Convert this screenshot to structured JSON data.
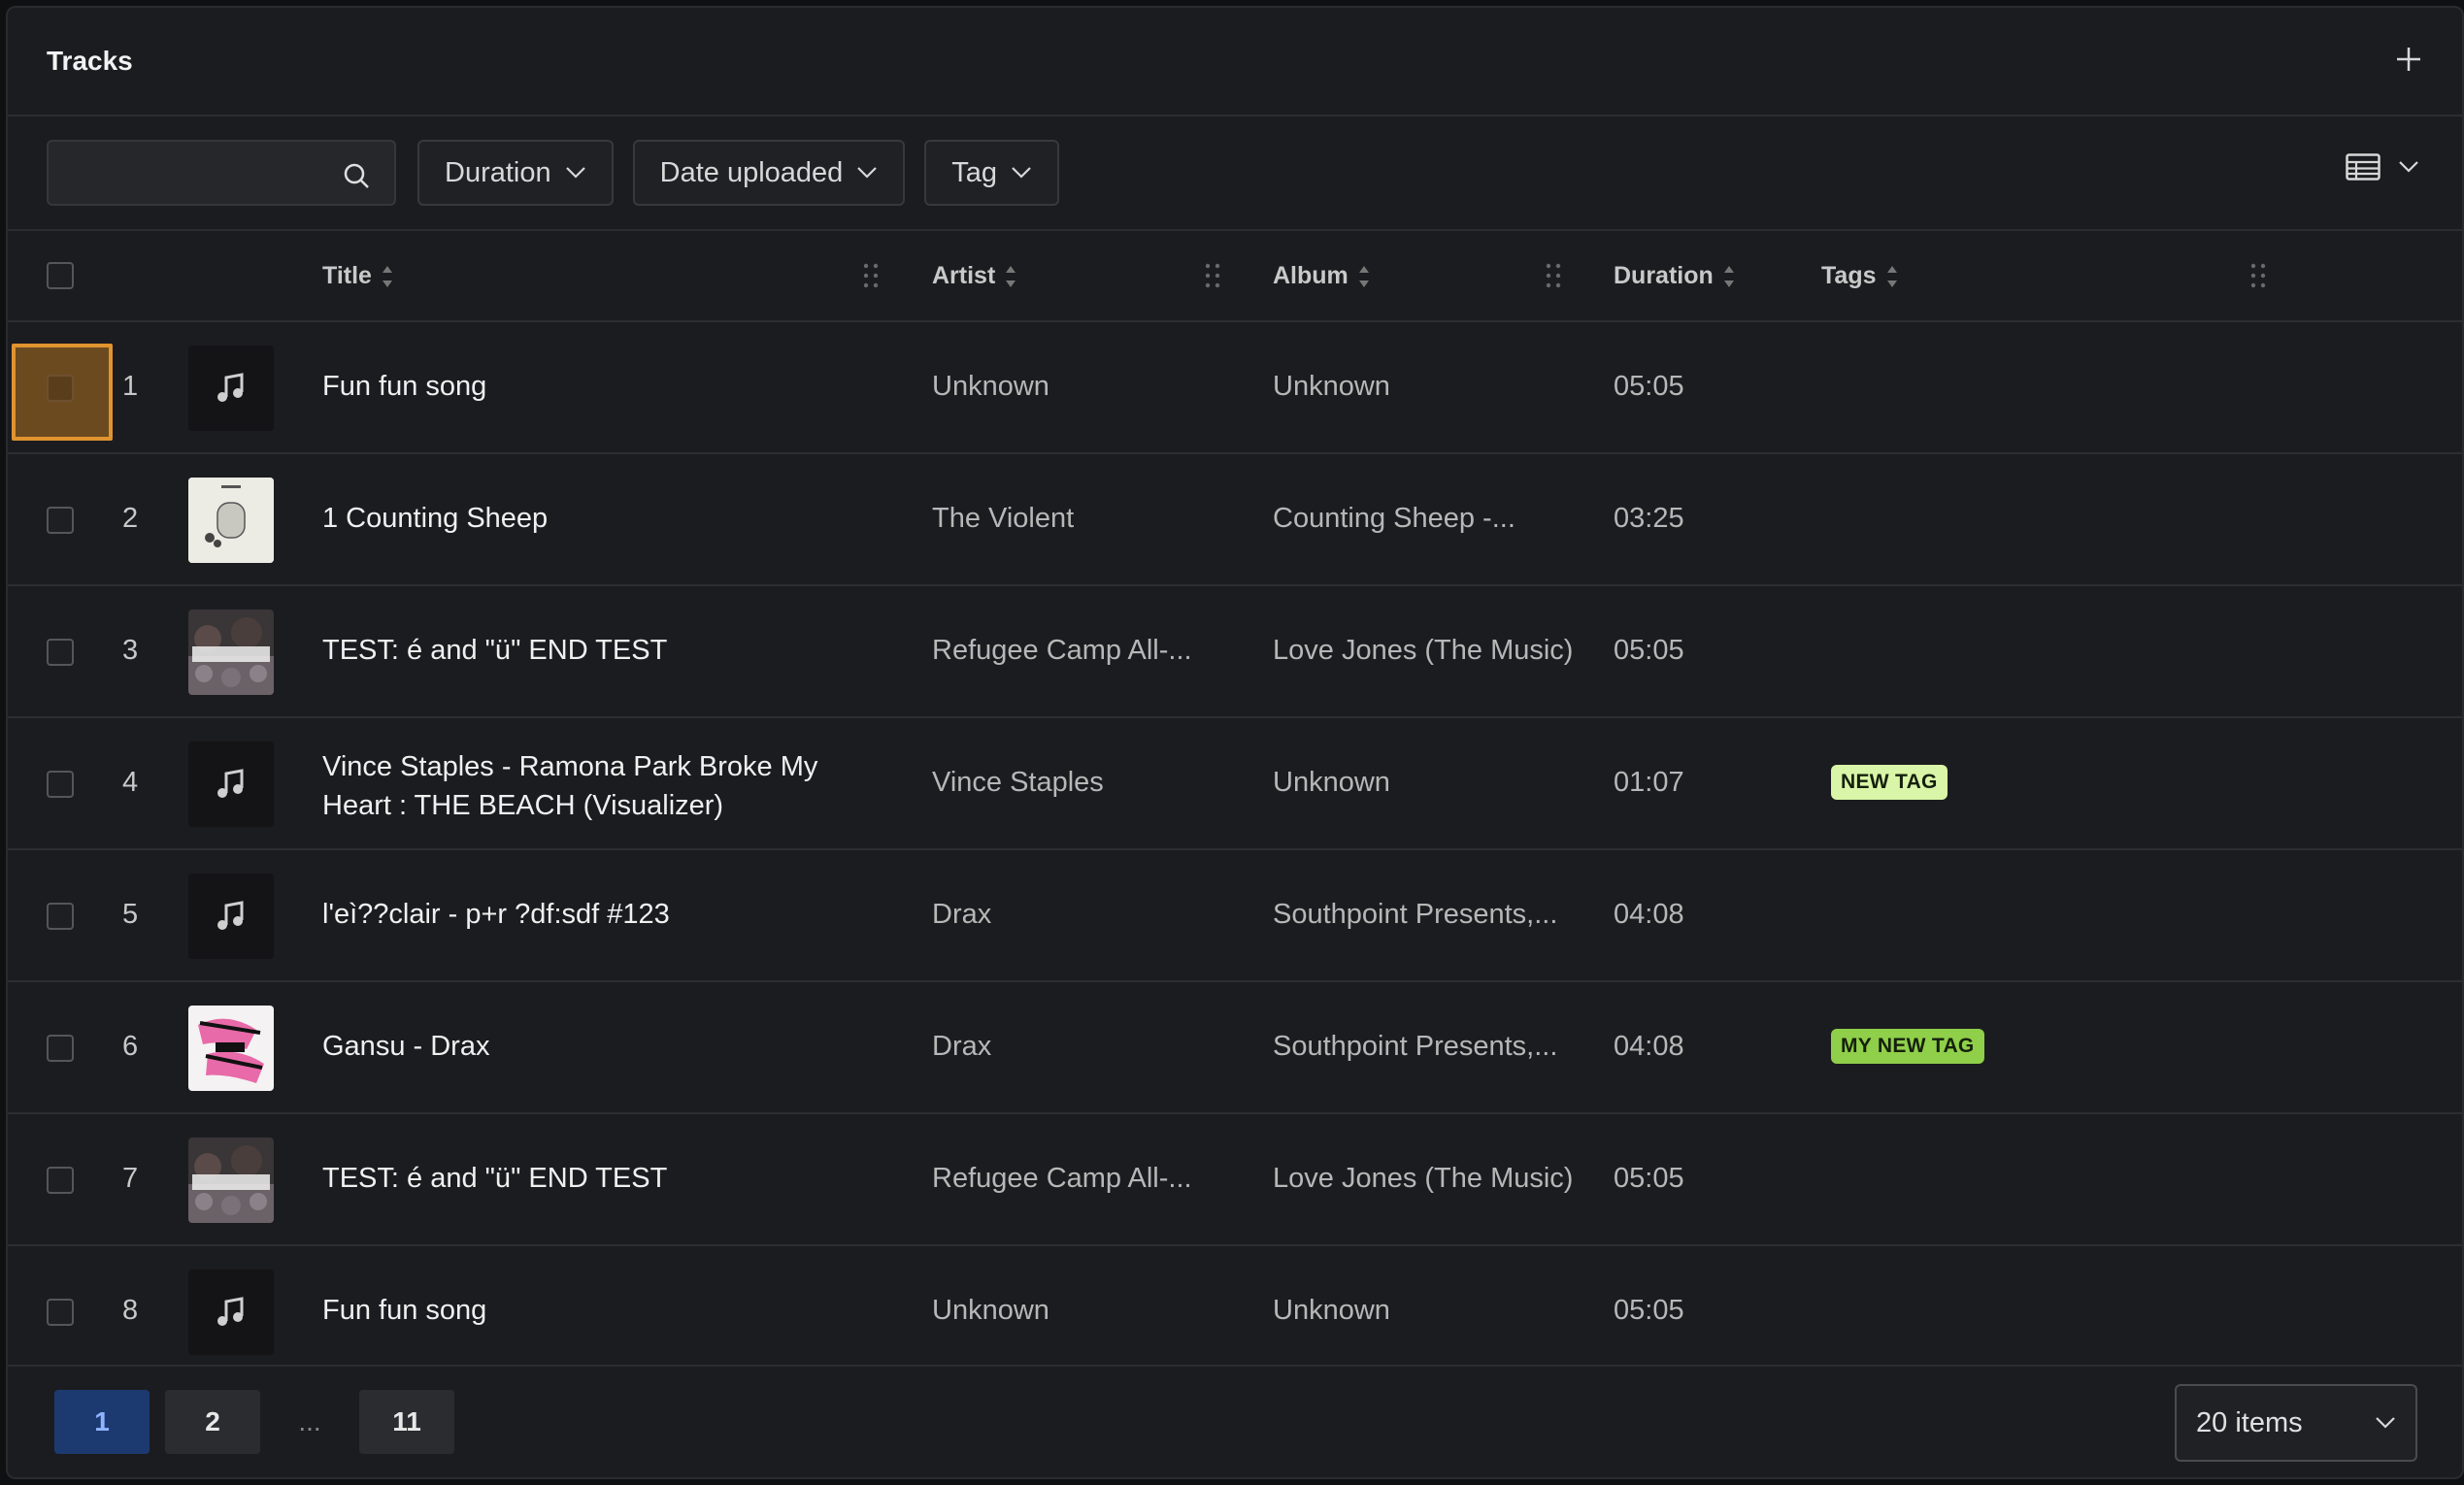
{
  "header": {
    "title": "Tracks",
    "add_icon": "plus-icon"
  },
  "filters": {
    "search_placeholder": "",
    "search_value": "",
    "buttons": [
      "Duration",
      "Date uploaded",
      "Tag"
    ]
  },
  "columns": {
    "title": "Title",
    "artist": "Artist",
    "album": "Album",
    "duration": "Duration",
    "tags": "Tags"
  },
  "rows": [
    {
      "num": "1",
      "title": "Fun fun song",
      "artist": "Unknown",
      "album": "Unknown",
      "duration": "05:05",
      "tag": ""
    },
    {
      "num": "2",
      "title": "1 Counting Sheep",
      "artist": "The Violent",
      "album": "Counting Sheep -...",
      "duration": "03:25",
      "tag": ""
    },
    {
      "num": "3",
      "title": "TEST: é and \"ü\" END TEST",
      "artist": "Refugee Camp All-...",
      "album": "Love Jones (The Music)",
      "duration": "05:05",
      "tag": ""
    },
    {
      "num": "4",
      "title": "Vince Staples - Ramona Park Broke My Heart : THE BEACH (Visualizer)",
      "artist": "Vince Staples",
      "album": "Unknown",
      "duration": "01:07",
      "tag": "NEW TAG"
    },
    {
      "num": "5",
      "title": "l'eì??clair - p+r ?df:sdf #123",
      "artist": "Drax",
      "album": "Southpoint Presents,...",
      "duration": "04:08",
      "tag": ""
    },
    {
      "num": "6",
      "title": "Gansu - Drax",
      "artist": "Drax",
      "album": "Southpoint Presents,...",
      "duration": "04:08",
      "tag": "MY NEW TAG"
    },
    {
      "num": "7",
      "title": "TEST: é and \"ü\" END TEST",
      "artist": "Refugee Camp All-...",
      "album": "Love Jones (The Music)",
      "duration": "05:05",
      "tag": ""
    },
    {
      "num": "8",
      "title": "Fun fun song",
      "artist": "Unknown",
      "album": "Unknown",
      "duration": "05:05",
      "tag": ""
    }
  ],
  "pagination": {
    "pages": [
      "1",
      "2",
      "11"
    ],
    "ellipsis": "...",
    "items_per_page": "20 items"
  },
  "colors": {
    "tag_new": "#d9f5a8",
    "tag_my_new": "#8fcf4a",
    "active_page": "#1d3a70",
    "focus": "#e0942f"
  }
}
